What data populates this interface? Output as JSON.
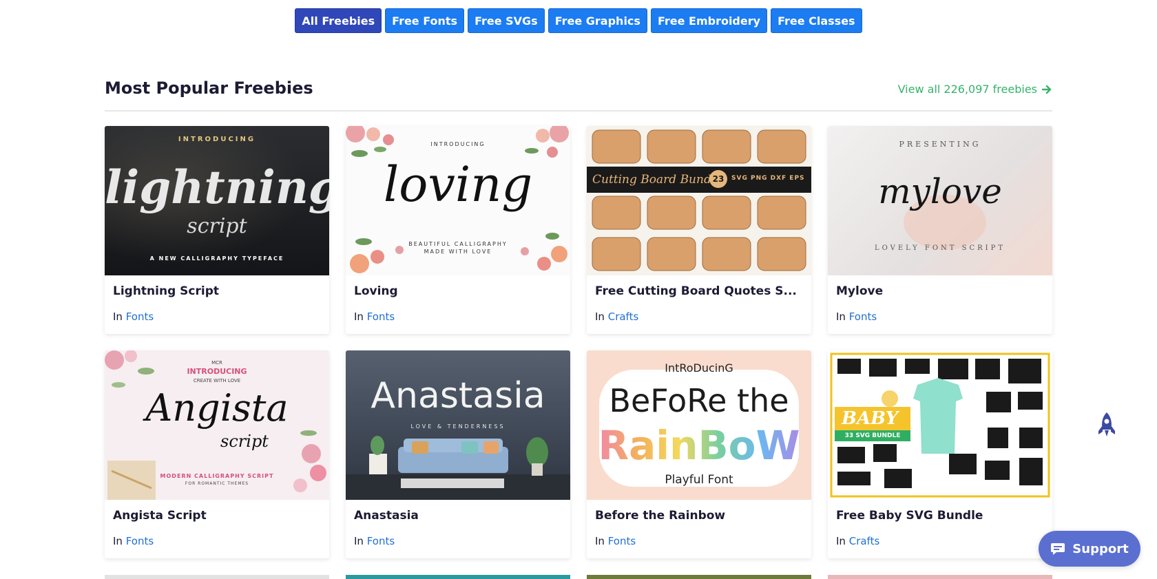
{
  "tabs": [
    {
      "label": "All Freebies",
      "active": true
    },
    {
      "label": "Free Fonts",
      "active": false
    },
    {
      "label": "Free SVGs",
      "active": false
    },
    {
      "label": "Free Graphics",
      "active": false
    },
    {
      "label": "Free Embroidery",
      "active": false
    },
    {
      "label": "Free Classes",
      "active": false
    }
  ],
  "section": {
    "title": "Most Popular Freebies",
    "view_all": "View all 226,097 freebies"
  },
  "cards": [
    {
      "title": "Lightning Script",
      "cat_prefix": "In",
      "category": "Fonts",
      "art": {
        "top": "INTRODUCING",
        "main": "lightning",
        "sub": "script",
        "bottom": "A NEW CALLIGRAPHY TYPEFACE"
      }
    },
    {
      "title": "Loving",
      "cat_prefix": "In",
      "category": "Fonts",
      "art": {
        "top": "INTRODUCING",
        "main": "loving",
        "bottom1": "BEAUTIFUL CALLIGRAPHY",
        "bottom2": "MADE WITH LOVE"
      }
    },
    {
      "title": "Free Cutting Board Quotes S...",
      "cat_prefix": "In",
      "category": "Crafts",
      "art": {
        "banner": "Cutting Board Bundle",
        "count": "23",
        "formats": "SVG PNG DXF EPS"
      }
    },
    {
      "title": "Mylove",
      "cat_prefix": "In",
      "category": "Fonts",
      "art": {
        "top": "PRESENTING",
        "main": "mylove",
        "bottom": "LOVELY FONT SCRIPT"
      }
    },
    {
      "title": "Angista Script",
      "cat_prefix": "In",
      "category": "Fonts",
      "art": {
        "brand": "MCR",
        "top": "INTRODUCING",
        "top2": "CREATE WITH LOVE",
        "main": "Angista",
        "sub": "script",
        "bottom1": "MODERN CALLIGRAPHY SCRIPT",
        "bottom2": "FOR ROMANTIC THEMES"
      }
    },
    {
      "title": "Anastasia",
      "cat_prefix": "In",
      "category": "Fonts",
      "art": {
        "main": "Anastasia",
        "sub": "LOVE & TENDERNESS"
      }
    },
    {
      "title": "Before the Rainbow",
      "cat_prefix": "In",
      "category": "Fonts",
      "art": {
        "top": "IntRoDucinG",
        "main": "BeFoRe the",
        "rainbow": "RainBoW",
        "bottom": "Playful Font"
      }
    },
    {
      "title": "Free Baby SVG Bundle",
      "cat_prefix": "In",
      "category": "Crafts",
      "art": {
        "badge": "BABY",
        "badge_sub": "33 SVG BUNDLE"
      }
    }
  ],
  "support_label": "Support",
  "colors": {
    "tab": "#1c7cf2",
    "tab_active": "#2f47b8",
    "link_green": "#34b36a",
    "category_link": "#1f6fd6",
    "support_bg": "#5b6fd1"
  },
  "icons": [
    "arrow-right-icon",
    "rocket-icon",
    "chat-bubble-icon"
  ]
}
